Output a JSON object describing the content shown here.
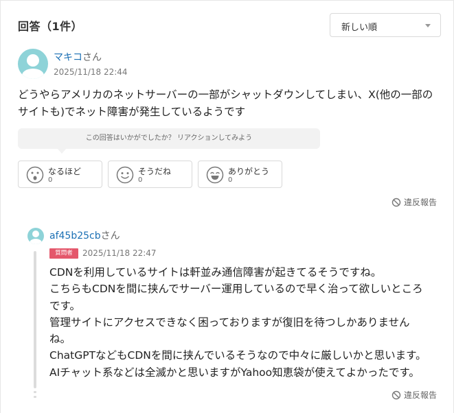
{
  "header": {
    "title": "回答（1件）",
    "sort_value": "新しい順"
  },
  "answer": {
    "user_name": "マキコ",
    "honorific": "さん",
    "date": "2025/11/18 22:44",
    "text": "どうやらアメリカのネットサーバーの一部がシャットダウンしてしまい、X(他の一部のサイトも)でネット障害が発生しているようです",
    "reaction_prompt": "この回答はいかがでしたか？ リアクションしてみよう",
    "reactions": [
      {
        "label": "なるほど",
        "count": "0",
        "icon": "surprised-face-icon"
      },
      {
        "label": "そうだね",
        "count": "0",
        "icon": "smile-face-icon"
      },
      {
        "label": "ありがとう",
        "count": "0",
        "icon": "grin-face-icon"
      }
    ],
    "report_label": "違反報告"
  },
  "reply": {
    "user_name": "af45b25cb",
    "honorific": "さん",
    "badge": "質問者",
    "date": "2025/11/18 22:47",
    "lines": [
      "CDNを利用しているサイトは軒並み通信障害が起きてるそうですね。",
      "こちらもCDNを間に挟んでサーバー運用しているので早く治って欲しいところ",
      "です。",
      "管理サイトにアクセスできなく困っておりますが復旧を待つしかありません",
      "ね。",
      "ChatGPTなどもCDNを間に挟んでいるそうなので中々に厳しいかと思います。",
      "AIチャット系などは全滅かと思いますがYahoo知恵袋が使えてよかったです。"
    ],
    "report_label": "違反報告"
  },
  "colors": {
    "link": "#1a6fb4",
    "avatar": "#8ed3d8",
    "badge": "#e4576b",
    "border": "#d9d9d9"
  }
}
